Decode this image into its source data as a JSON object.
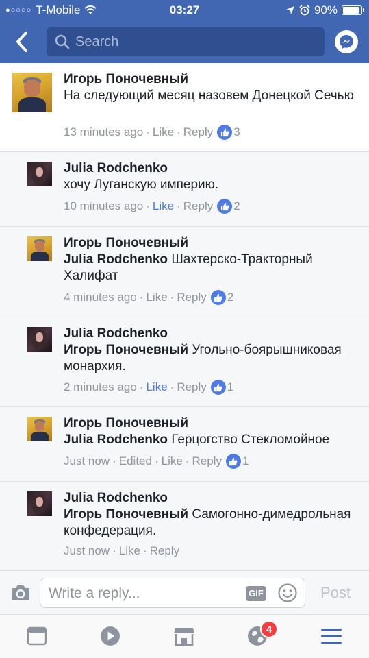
{
  "status_bar": {
    "carrier": "T-Mobile",
    "time": "03:27",
    "battery": "90%",
    "battery_level": 0.9
  },
  "nav": {
    "search_placeholder": "Search"
  },
  "comments": [
    {
      "author": "Игорь Поночевный",
      "text": "На следующий месяц назовем Донецкой Сечью",
      "time": "13 minutes ago",
      "like": "Like",
      "reply": "Reply",
      "likes": "3"
    },
    {
      "author": "Julia Rodchenko",
      "text": "хочу Луганскую империю.",
      "time": "10 minutes ago",
      "like": "Like",
      "reply": "Reply",
      "likes": "2"
    },
    {
      "author": "Игорь Поночевный",
      "mention": "Julia Rodchenko",
      "text": "Шахтерско-Тракторный Халифат",
      "time": "4 minutes ago",
      "like": "Like",
      "reply": "Reply",
      "likes": "2"
    },
    {
      "author": "Julia Rodchenko",
      "mention": "Игорь Поночевный",
      "text": "Угольно-боярышниковая монархия.",
      "time": "2 minutes ago",
      "like": "Like",
      "reply": "Reply",
      "likes": "1"
    },
    {
      "author": "Игорь Поночевный",
      "mention": "Julia Rodchenko",
      "text": "Герцогство Стекломойное",
      "time": "Just now",
      "edited": "Edited",
      "like": "Like",
      "reply": "Reply",
      "likes": "1"
    },
    {
      "author": "Julia Rodchenko",
      "mention": "Игорь Поночевный",
      "text": "Самогонно-димедрольная конфедерация.",
      "time": "Just now",
      "like": "Like",
      "reply": "Reply"
    }
  ],
  "composer": {
    "placeholder": "Write a reply...",
    "gif_label": "GIF",
    "post_label": "Post"
  },
  "tabbar": {
    "notifications_badge": "4"
  },
  "colors": {
    "brand": "#4267b2",
    "like_active": "#4f7be4",
    "badge": "#fa3e3e"
  }
}
